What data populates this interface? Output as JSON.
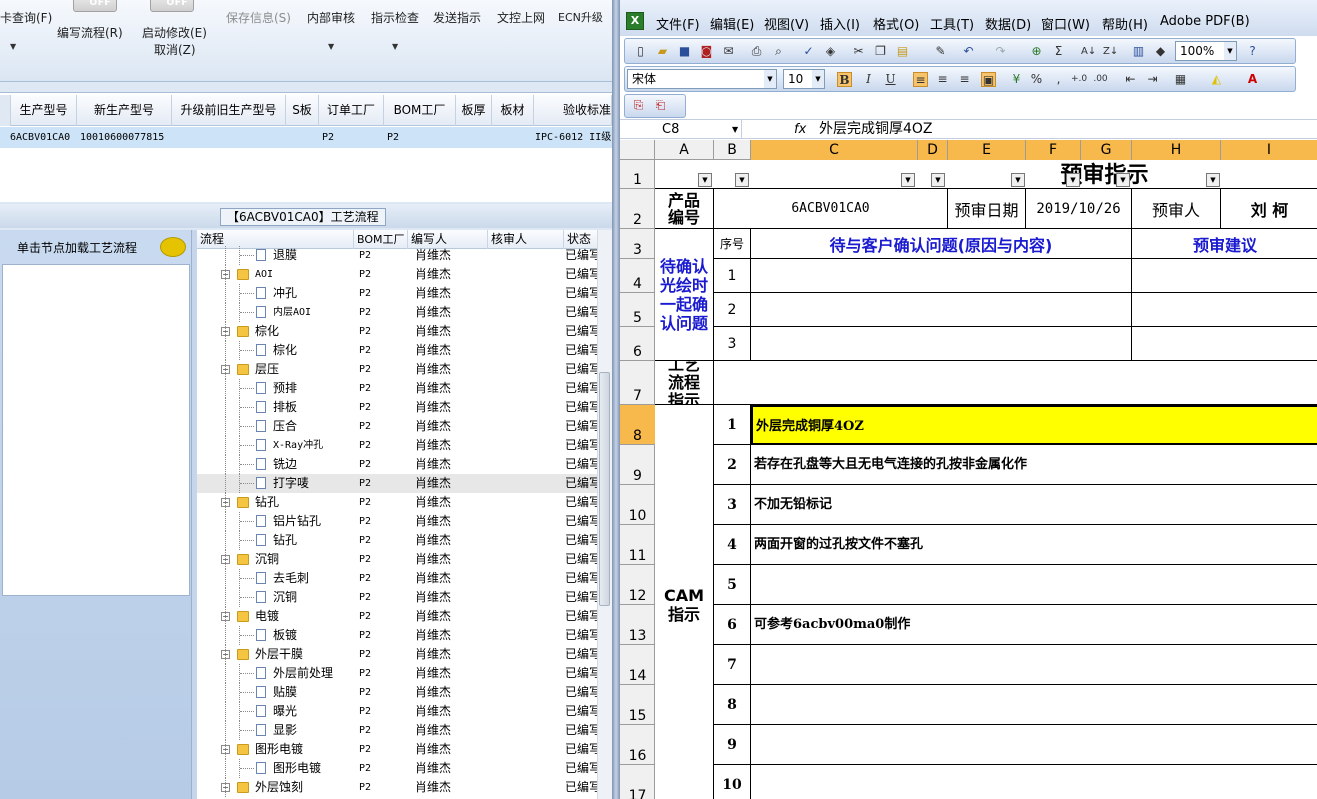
{
  "left_app": {
    "toolbar": {
      "query_label": "卡查询(F)",
      "toggle1_text": "OFF",
      "toggle2_text": "OFF",
      "write_flow": "编写流程(R)",
      "start_edit": "启动修改(E)",
      "cancel": "取消(Z)",
      "save_info": "保存信息(S)",
      "internal_review": "内部审核",
      "instruction_check": "指示检查",
      "send_instruction": "发送指示",
      "upload": "文控上网",
      "ecn_upgrade": "ECN升级"
    },
    "grid": {
      "headers": [
        "生产型号",
        "新生产型号",
        "升级前旧生产型号",
        "S板",
        "订单工厂",
        "BOM工厂",
        "板厚",
        "板材",
        "验收标准"
      ],
      "row": [
        "6ACBV01CA0",
        "10010600077815",
        "",
        "",
        "P2",
        "P2",
        "",
        "",
        "IPC-6012 II级"
      ]
    },
    "process_title": "【6ACBV01CA0】工艺流程",
    "left_panel_label": "单击节点加载工艺流程",
    "tree": {
      "headers": [
        "流程",
        "BOM工厂",
        "编写人",
        "核审人",
        "状态"
      ],
      "rows": [
        {
          "name": "退膜",
          "level": 2,
          "bom": "P2",
          "writer": "肖维杰",
          "status": "已编写"
        },
        {
          "name": "AOI",
          "level": 1,
          "bom": "P2",
          "writer": "肖维杰",
          "status": "已编写"
        },
        {
          "name": "冲孔",
          "level": 2,
          "bom": "P2",
          "writer": "肖维杰",
          "status": "已编写"
        },
        {
          "name": "内层AOI",
          "level": 2,
          "bom": "P2",
          "writer": "肖维杰",
          "status": "已编写"
        },
        {
          "name": "棕化",
          "level": 1,
          "bom": "P2",
          "writer": "肖维杰",
          "status": "已编写"
        },
        {
          "name": "棕化",
          "level": 2,
          "bom": "P2",
          "writer": "肖维杰",
          "status": "已编写"
        },
        {
          "name": "层压",
          "level": 1,
          "bom": "P2",
          "writer": "肖维杰",
          "status": "已编写"
        },
        {
          "name": "预排",
          "level": 2,
          "bom": "P2",
          "writer": "肖维杰",
          "status": "已编写"
        },
        {
          "name": "排板",
          "level": 2,
          "bom": "P2",
          "writer": "肖维杰",
          "status": "已编写"
        },
        {
          "name": "压合",
          "level": 2,
          "bom": "P2",
          "writer": "肖维杰",
          "status": "已编写"
        },
        {
          "name": "X-Ray冲孔",
          "level": 2,
          "bom": "P2",
          "writer": "肖维杰",
          "status": "已编写"
        },
        {
          "name": "铣边",
          "level": 2,
          "bom": "P2",
          "writer": "肖维杰",
          "status": "已编写"
        },
        {
          "name": "打字唛",
          "level": 2,
          "bom": "P2",
          "writer": "肖维杰",
          "status": "已编写"
        },
        {
          "name": "钻孔",
          "level": 1,
          "bom": "P2",
          "writer": "肖维杰",
          "status": "已编写"
        },
        {
          "name": "铝片钻孔",
          "level": 2,
          "bom": "P2",
          "writer": "肖维杰",
          "status": "已编写"
        },
        {
          "name": "钻孔",
          "level": 2,
          "bom": "P2",
          "writer": "肖维杰",
          "status": "已编写"
        },
        {
          "name": "沉铜",
          "level": 1,
          "bom": "P2",
          "writer": "肖维杰",
          "status": "已编写"
        },
        {
          "name": "去毛刺",
          "level": 2,
          "bom": "P2",
          "writer": "肖维杰",
          "status": "已编写"
        },
        {
          "name": "沉铜",
          "level": 2,
          "bom": "P2",
          "writer": "肖维杰",
          "status": "已编写"
        },
        {
          "name": "电镀",
          "level": 1,
          "bom": "P2",
          "writer": "肖维杰",
          "status": "已编写"
        },
        {
          "name": "板镀",
          "level": 2,
          "bom": "P2",
          "writer": "肖维杰",
          "status": "已编写"
        },
        {
          "name": "外层干膜",
          "level": 1,
          "bom": "P2",
          "writer": "肖维杰",
          "status": "已编写"
        },
        {
          "name": "外层前处理",
          "level": 2,
          "bom": "P2",
          "writer": "肖维杰",
          "status": "已编写"
        },
        {
          "name": "贴膜",
          "level": 2,
          "bom": "P2",
          "writer": "肖维杰",
          "status": "已编写"
        },
        {
          "name": "曝光",
          "level": 2,
          "bom": "P2",
          "writer": "肖维杰",
          "status": "已编写"
        },
        {
          "name": "显影",
          "level": 2,
          "bom": "P2",
          "writer": "肖维杰",
          "status": "已编写"
        },
        {
          "name": "图形电镀",
          "level": 1,
          "bom": "P2",
          "writer": "肖维杰",
          "status": "已编写"
        },
        {
          "name": "图形电镀",
          "level": 2,
          "bom": "P2",
          "writer": "肖维杰",
          "status": "已编写"
        },
        {
          "name": "外层蚀刻",
          "level": 1,
          "bom": "P2",
          "writer": "肖维杰",
          "status": "已编写"
        }
      ],
      "selected_index": 12
    }
  },
  "excel": {
    "menu": [
      "文件(F)",
      "编辑(E)",
      "视图(V)",
      "插入(I)",
      "格式(O)",
      "工具(T)",
      "数据(D)",
      "窗口(W)",
      "帮助(H)",
      "Adobe PDF(B)"
    ],
    "zoom": "100%",
    "font_name": "宋体",
    "font_size": "10",
    "name_box": "C8",
    "fx": "fx",
    "formula": "外层完成铜厚4OZ",
    "columns": [
      "A",
      "B",
      "C",
      "D",
      "E",
      "F",
      "G",
      "H",
      "I"
    ],
    "rows": [
      "1",
      "2",
      "3",
      "4",
      "5",
      "6",
      "7",
      "8",
      "9",
      "10",
      "11",
      "12",
      "13",
      "14",
      "15",
      "16",
      "17"
    ],
    "sheet": {
      "title": "预审指示",
      "product_label": "产品编号",
      "product_value": "6ACBV01CA0",
      "review_date_label": "预审日期",
      "review_date_value": "2019/10/26",
      "reviewer_label": "预审人",
      "reviewer_value": "刘 柯",
      "pending_label": "待确认光绘时一起确认问题",
      "seq_label": "序号",
      "issue_label": "待与客户确认问题(原因与内容)",
      "suggest_label": "预审建议",
      "pending_nums": [
        "1",
        "2",
        "3"
      ],
      "process_label": "工艺流程指示",
      "cam_label": "CAM指示",
      "cam_items": [
        {
          "num": "1",
          "text": "外层完成铜厚4OZ"
        },
        {
          "num": "2",
          "text": "若存在孔盘等大且无电气连接的孔按非金属化作"
        },
        {
          "num": "3",
          "text": "不加无铅标记"
        },
        {
          "num": "4",
          "text": "两面开窗的过孔按文件不塞孔"
        },
        {
          "num": "5",
          "text": ""
        },
        {
          "num": "6",
          "text": "可参考6acbv00ma0制作"
        },
        {
          "num": "7",
          "text": ""
        },
        {
          "num": "8",
          "text": ""
        },
        {
          "num": "9",
          "text": ""
        },
        {
          "num": "10",
          "text": ""
        }
      ]
    },
    "colors": {
      "selection": "#ffff00",
      "header_sel": "#f7b84c",
      "blue_text": "#1a1ad0"
    }
  }
}
